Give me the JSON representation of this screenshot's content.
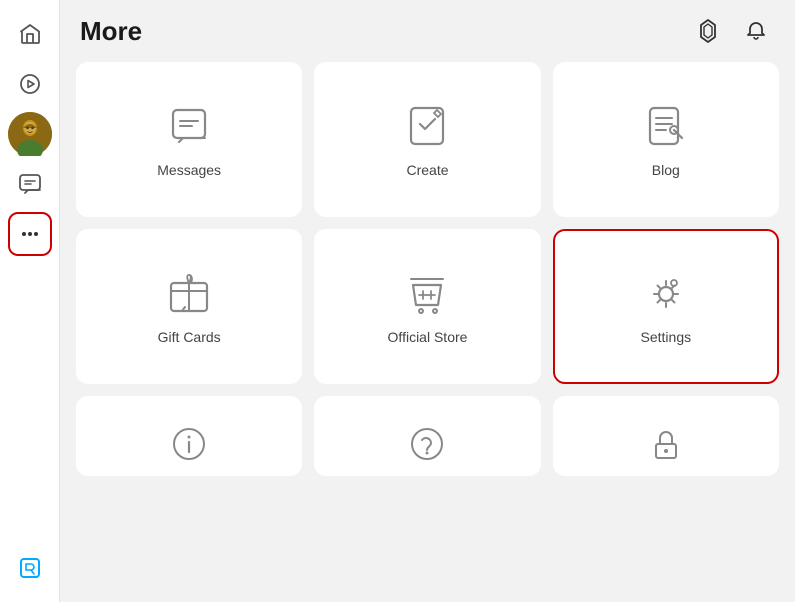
{
  "page": {
    "title": "More"
  },
  "header": {
    "robux_label": "Robux",
    "notifications_label": "Notifications"
  },
  "sidebar": {
    "items": [
      {
        "id": "home",
        "label": "Home",
        "icon": "home"
      },
      {
        "id": "discover",
        "label": "Discover",
        "icon": "play"
      },
      {
        "id": "avatar",
        "label": "Avatar",
        "icon": "avatar"
      },
      {
        "id": "chat",
        "label": "Chat",
        "icon": "chat"
      },
      {
        "id": "more",
        "label": "More",
        "icon": "more",
        "active": true,
        "highlighted": true
      }
    ],
    "bottom": [
      {
        "id": "robux",
        "label": "Robux",
        "icon": "robux"
      }
    ]
  },
  "grid": {
    "cards": [
      {
        "id": "messages",
        "label": "Messages",
        "icon": "messages"
      },
      {
        "id": "create",
        "label": "Create",
        "icon": "create"
      },
      {
        "id": "blog",
        "label": "Blog",
        "icon": "blog"
      },
      {
        "id": "gift-cards",
        "label": "Gift Cards",
        "icon": "gift-cards"
      },
      {
        "id": "official-store",
        "label": "Official Store",
        "icon": "official-store"
      },
      {
        "id": "settings",
        "label": "Settings",
        "icon": "settings",
        "highlighted": true
      },
      {
        "id": "about",
        "label": "About",
        "icon": "about"
      },
      {
        "id": "help",
        "label": "Help",
        "icon": "help"
      },
      {
        "id": "privacy",
        "label": "Privacy",
        "icon": "privacy"
      }
    ]
  }
}
